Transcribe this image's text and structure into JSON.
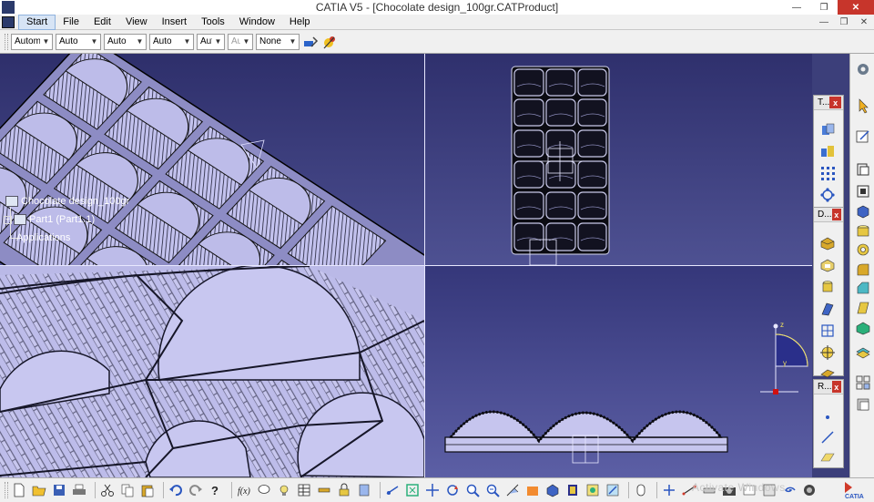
{
  "window": {
    "title": "CATIA V5 - [Chocolate design_100gr.CATProduct]",
    "minimize": "—",
    "restore": "❐",
    "close": "✕"
  },
  "menu": {
    "items": [
      "Start",
      "File",
      "Edit",
      "View",
      "Insert",
      "Tools",
      "Window",
      "Help"
    ],
    "inner_minimize": "—",
    "inner_restore": "❐",
    "inner_close": "✕"
  },
  "toolbar": {
    "combos": [
      {
        "value": "Automi",
        "disabled": false
      },
      {
        "value": "Auto",
        "disabled": false
      },
      {
        "value": "Auto",
        "disabled": false
      },
      {
        "value": "Auto",
        "disabled": false
      },
      {
        "value": "Aut",
        "disabled": false
      },
      {
        "value": "Aut",
        "disabled": true
      },
      {
        "value": "None",
        "disabled": false
      }
    ]
  },
  "tree": {
    "root": "Chocolate design_100gr",
    "part": "Part1 (Part1.1)",
    "applications": "Applications"
  },
  "compass": {
    "z_label": "z",
    "y_label": "y"
  },
  "floating_toolbars": [
    {
      "title": "T...",
      "close": "x"
    },
    {
      "title": "D...",
      "close": "x"
    },
    {
      "title": "R...",
      "close": "x"
    }
  ],
  "watermark": "Activate Windows",
  "logo_text": "CATIA",
  "colors": {
    "viewport_bg": "#3c3f7a",
    "model_face": "#b9b8e6",
    "model_dark": "#0a0a10",
    "close_red": "#c7352b",
    "compass_blue": "#2a2f8a",
    "compass_yellow": "#f0e060",
    "origin_red": "#d01010"
  }
}
